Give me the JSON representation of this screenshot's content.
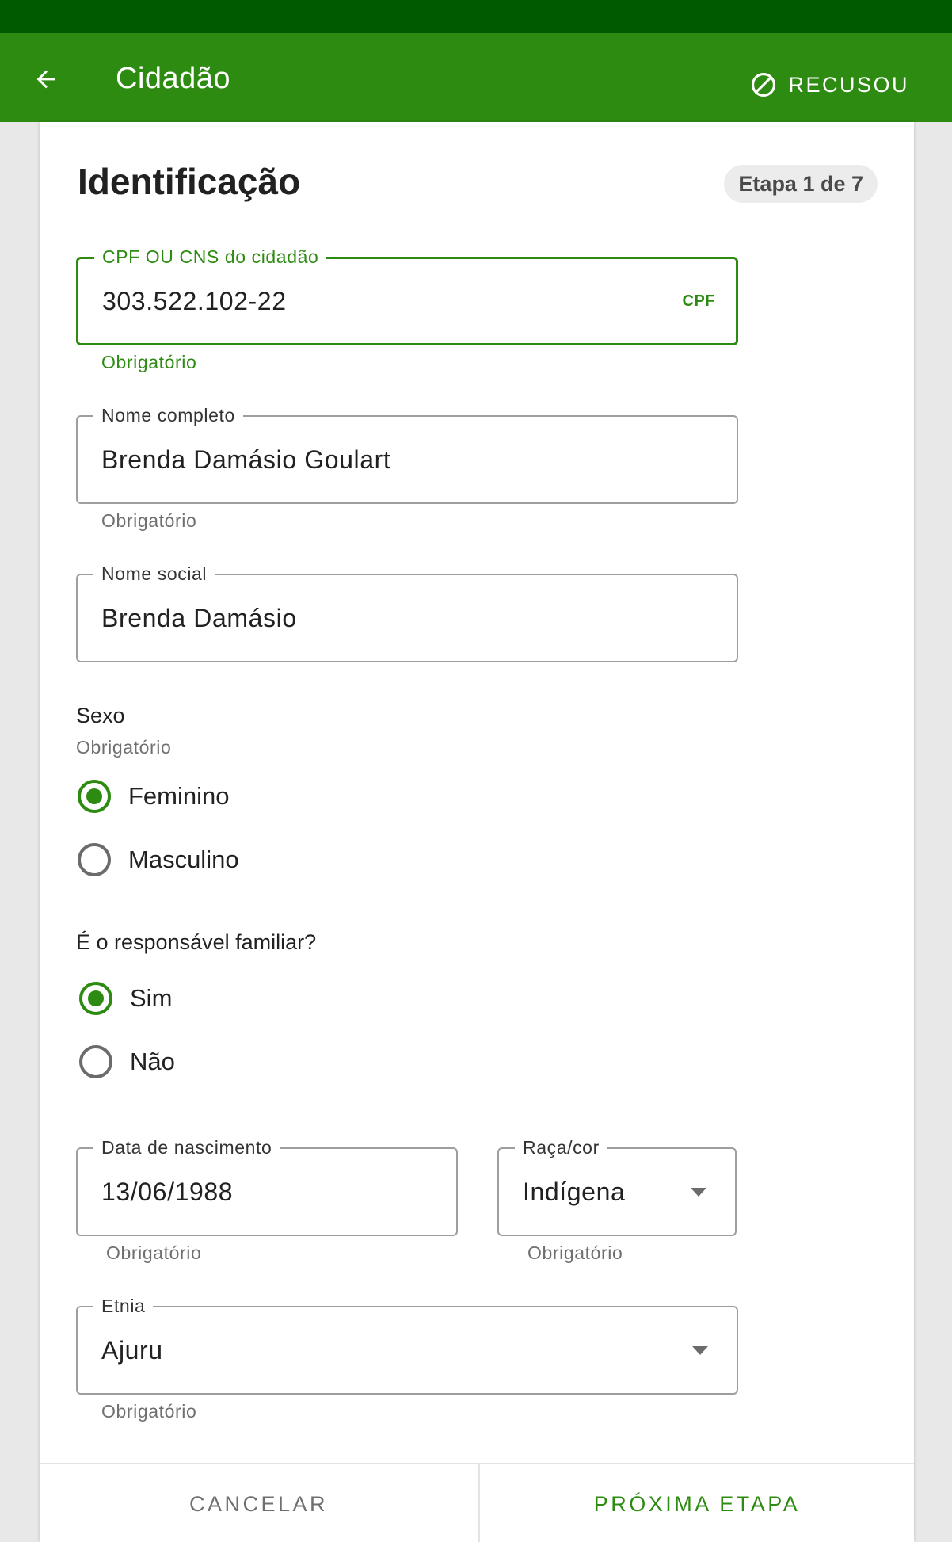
{
  "app_bar": {
    "title": "Cidadão",
    "refused_label": "RECUSOU"
  },
  "section": {
    "title": "Identificação",
    "step": "Etapa 1 de 7"
  },
  "fields": {
    "cpf_cns": {
      "label": "CPF OU CNS do cidadão",
      "value": "303.522.102-22",
      "tag": "CPF",
      "helper": "Obrigatório"
    },
    "full_name": {
      "label": "Nome completo",
      "value": "Brenda Damásio Goulart",
      "helper": "Obrigatório"
    },
    "social_name": {
      "label": "Nome social",
      "value": "Brenda Damásio"
    },
    "birth_date": {
      "label": "Data de nascimento",
      "value": "13/06/1988",
      "helper": "Obrigatório"
    },
    "race": {
      "label": "Raça/cor",
      "value": "Indígena",
      "helper": "Obrigatório"
    },
    "ethnicity": {
      "label": "Etnia",
      "value": "Ajuru",
      "helper": "Obrigatório"
    }
  },
  "sex": {
    "label": "Sexo",
    "helper": "Obrigatório",
    "options": [
      "Feminino",
      "Masculino"
    ],
    "selected": "Feminino"
  },
  "family_head": {
    "label": "É o responsável familiar?",
    "options": [
      "Sim",
      "Não"
    ],
    "selected": "Sim"
  },
  "footer": {
    "cancel_label": "CANCELAR",
    "next_label": "PRÓXIMA ETAPA"
  },
  "colors": {
    "status_bar": "#005a00",
    "app_bar": "#2e8b12",
    "accent": "#2e8b12"
  }
}
